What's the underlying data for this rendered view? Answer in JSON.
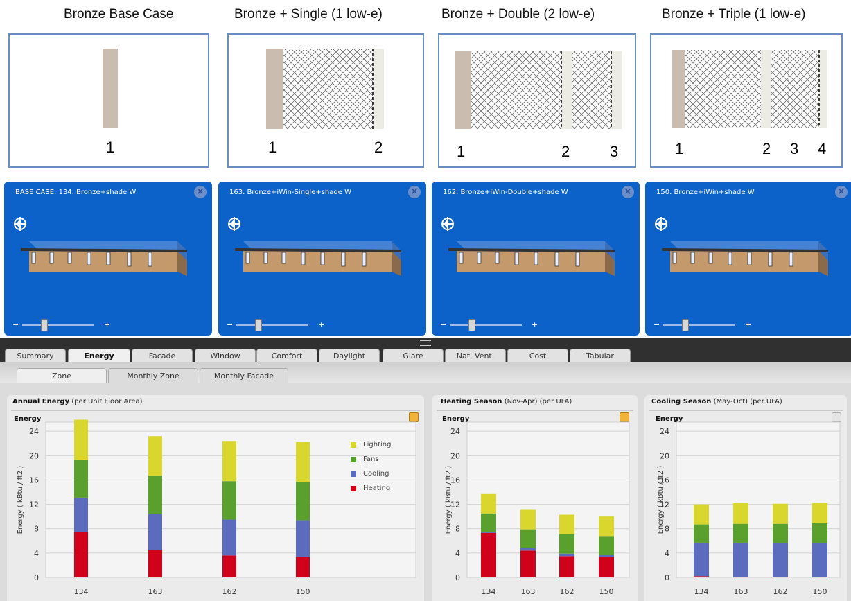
{
  "diagrams": [
    {
      "caption": "Bronze Base Case",
      "labels": [
        "1"
      ]
    },
    {
      "caption": "Bronze + Single (1 low-e)",
      "labels": [
        "1",
        "2"
      ]
    },
    {
      "caption": "Bronze + Double (2 low-e)",
      "labels": [
        "1",
        "2",
        "3"
      ]
    },
    {
      "caption": "Bronze + Triple (1 low-e)",
      "labels": [
        "1",
        "2",
        "3",
        "4"
      ]
    }
  ],
  "panels": [
    {
      "title": "BASE CASE: 134. Bronze+shade W"
    },
    {
      "title": "163. Bronze+iWin-Single+shade W"
    },
    {
      "title": "162. Bronze+iWin-Double+shade W"
    },
    {
      "title": "150. Bronze+iWin+shade W"
    }
  ],
  "zoom": {
    "minus": "−",
    "plus": "+",
    "level": 0.3
  },
  "tabs": [
    {
      "label": "Summary"
    },
    {
      "label": "Energy"
    },
    {
      "label": "Facade"
    },
    {
      "label": "Window"
    },
    {
      "label": "Comfort"
    },
    {
      "label": "Daylight"
    },
    {
      "label": "Glare"
    },
    {
      "label": "Nat. Vent."
    },
    {
      "label": "Cost"
    },
    {
      "label": "Tabular"
    }
  ],
  "active_tab": "Energy",
  "subtabs": [
    {
      "label": "Zone"
    },
    {
      "label": "Monthly Zone"
    },
    {
      "label": "Monthly Facade"
    }
  ],
  "cards": [
    {
      "title": "Annual Energy",
      "subtitle": "(per Unit Floor Area)",
      "section": "Energy"
    },
    {
      "title": "Heating Season",
      "subtitle": "(Nov-Apr) (per UFA)",
      "section": "Energy"
    },
    {
      "title": "Cooling Season",
      "subtitle": "(May-Oct) (per UFA)",
      "section": "Energy"
    }
  ],
  "colors": {
    "lighting": "#d9d62e",
    "fans": "#5aa02c",
    "cooling": "#5b6bbd",
    "heating": "#d0021b",
    "panel_blue": "#0d62c9"
  },
  "chart_data": [
    {
      "type": "bar",
      "title": "Annual Energy",
      "ylabel": "Energy ( kBtu / ft2 )",
      "ylim": [
        0,
        25.5
      ],
      "yticks": [
        0,
        4,
        8,
        12,
        16,
        20,
        24
      ],
      "categories": [
        "134",
        "163",
        "162",
        "150"
      ],
      "stacked": true,
      "legend": "right",
      "series": [
        {
          "name": "Heating",
          "values": [
            7.4,
            4.5,
            3.6,
            3.4
          ]
        },
        {
          "name": "Cooling",
          "values": [
            5.7,
            5.9,
            5.9,
            6.0
          ]
        },
        {
          "name": "Fans",
          "values": [
            6.2,
            6.3,
            6.3,
            6.3
          ]
        },
        {
          "name": "Lighting",
          "values": [
            6.6,
            6.5,
            6.6,
            6.5
          ]
        }
      ]
    },
    {
      "type": "bar",
      "title": "Heating Season",
      "ylabel": "Energy ( kBtu / ft2 )",
      "ylim": [
        0,
        25.5
      ],
      "yticks": [
        0,
        4,
        8,
        12,
        16,
        20,
        24
      ],
      "categories": [
        "134",
        "163",
        "162",
        "150"
      ],
      "stacked": true,
      "series": [
        {
          "name": "Heating",
          "values": [
            7.3,
            4.4,
            3.5,
            3.3
          ]
        },
        {
          "name": "Cooling",
          "values": [
            0.2,
            0.4,
            0.4,
            0.4
          ]
        },
        {
          "name": "Fans",
          "values": [
            3.0,
            3.1,
            3.2,
            3.1
          ]
        },
        {
          "name": "Lighting",
          "values": [
            3.3,
            3.2,
            3.2,
            3.2
          ]
        }
      ]
    },
    {
      "type": "bar",
      "title": "Cooling Season",
      "ylabel": "Energy ( kBtu / ft2 )",
      "ylim": [
        0,
        25.5
      ],
      "yticks": [
        0,
        4,
        8,
        12,
        16,
        20,
        24
      ],
      "categories": [
        "134",
        "163",
        "162",
        "150"
      ],
      "stacked": true,
      "series": [
        {
          "name": "Heating",
          "values": [
            0.2,
            0.1,
            0.1,
            0.1
          ]
        },
        {
          "name": "Cooling",
          "values": [
            5.5,
            5.6,
            5.5,
            5.5
          ]
        },
        {
          "name": "Fans",
          "values": [
            3.0,
            3.1,
            3.2,
            3.3
          ]
        },
        {
          "name": "Lighting",
          "values": [
            3.3,
            3.4,
            3.3,
            3.3
          ]
        }
      ]
    }
  ]
}
